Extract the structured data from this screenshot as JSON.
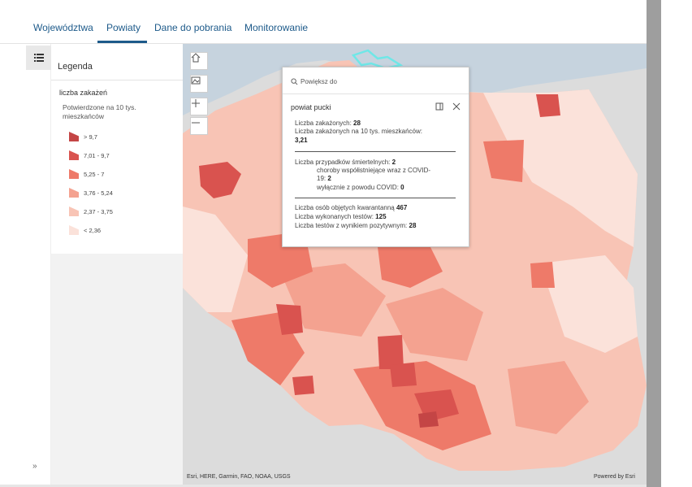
{
  "tabs": [
    {
      "label": "Województwa",
      "active": false
    },
    {
      "label": "Powiaty",
      "active": true
    },
    {
      "label": "Dane do pobrania",
      "active": false
    },
    {
      "label": "Monitorowanie",
      "active": false
    }
  ],
  "legend": {
    "title": "Legenda",
    "layer_name": "liczba zakażeń",
    "field_label": "Potwierdzone na 10 tys. mieszkańców",
    "classes": [
      {
        "label": "> 9,7",
        "color": "#c44545"
      },
      {
        "label": "7,01 - 9,7",
        "color": "#d9534f"
      },
      {
        "label": "5,25 - 7",
        "color": "#ee7a69"
      },
      {
        "label": "3,76 - 5,24",
        "color": "#f4a290"
      },
      {
        "label": "2,37 - 3,75",
        "color": "#f8c4b5"
      },
      {
        "label": "< 2,36",
        "color": "#fbe2da"
      }
    ]
  },
  "sidebar": {
    "expand_label": "»"
  },
  "map": {
    "attribution": "Esri, HERE, Garmin, FAO, NOAA, USGS",
    "powered_by": "Powered by Esri",
    "land_color": "#dcdcdc",
    "water_color": "#c6d3de",
    "selection_color": "#6fe7e7"
  },
  "popup": {
    "zoom_label": "Powiększ do",
    "title": "powiat pucki",
    "lines": {
      "l1_label": "Liczba zakażonych: ",
      "l1_value": "28",
      "l2_label": "Liczba zakażonych na 10 tys. mieszkańców:",
      "l2_value": "3,21",
      "l3_label": "Liczba przypadków śmiertelnych: ",
      "l3_value": "2",
      "l4_label": "choroby współistniejące wraz z COVID-",
      "l5_label": "19: ",
      "l5_value": "2",
      "l6_label": "wyłącznie z powodu COVID: ",
      "l6_value": "0",
      "l7_label": "Liczba osób objętych kwarantanną ",
      "l7_value": "467",
      "l8_label": "Liczba wykonanych testów: ",
      "l8_value": "125",
      "l9_label": "Liczba testów z wynikiem pozytywnym: ",
      "l9_value": "28"
    }
  }
}
